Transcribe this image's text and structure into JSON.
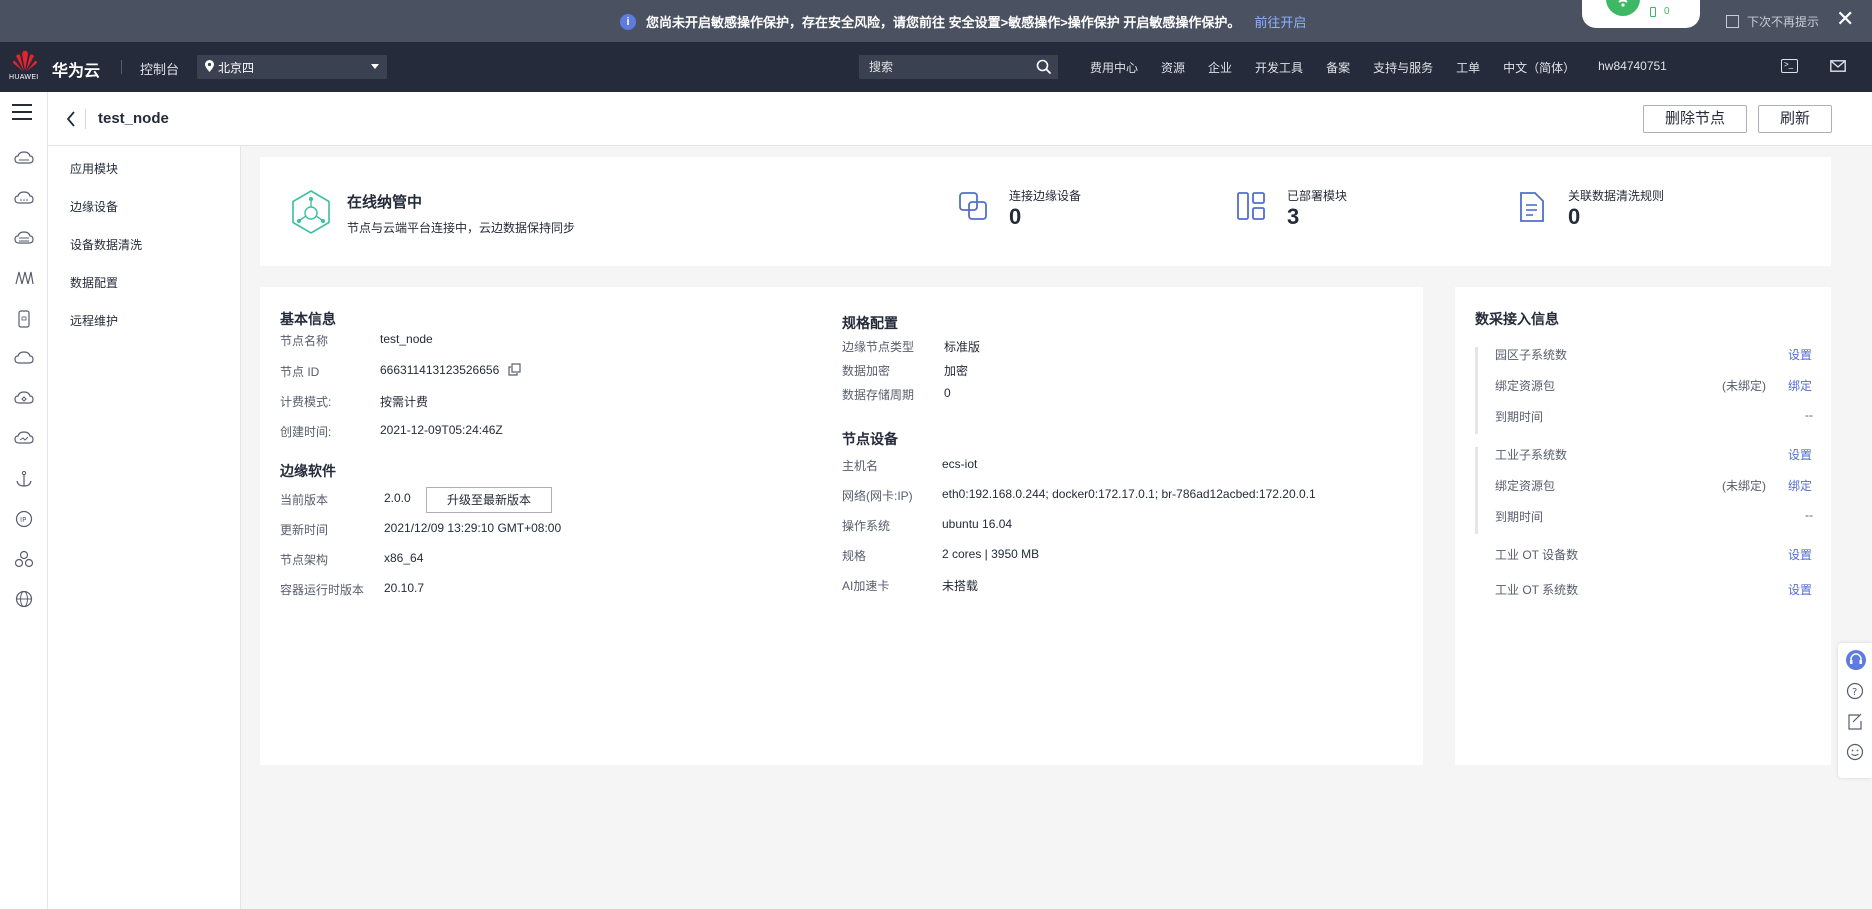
{
  "notice": {
    "message": "您尚未开启敏感操作保护，存在安全风险，请您前往 安全设置>敏感操作>操作保护 开启敏感操作保护。",
    "link": "前往开启",
    "wifi_count": "0",
    "no_remind": "下次不再提示"
  },
  "header": {
    "logo_text": "HUAWEI",
    "brand": "华为云",
    "console": "控制台",
    "region": "北京四",
    "search_placeholder": "搜索",
    "nav": [
      "费用中心",
      "资源",
      "企业",
      "开发工具",
      "备案",
      "支持与服务",
      "工单",
      "中文（简体）",
      "hw84740751"
    ],
    "term_glyph": ">_"
  },
  "subheader": {
    "title": "test_node",
    "delete_label": "删除节点",
    "refresh_label": "刷新"
  },
  "subnav": [
    "应用模块",
    "边缘设备",
    "设备数据清洗",
    "数据配置",
    "远程维护"
  ],
  "status": {
    "title": "在线纳管中",
    "desc": "节点与云端平台连接中，云边数据保持同步",
    "metrics": [
      {
        "label": "连接边缘设备",
        "value": "0"
      },
      {
        "label": "已部署模块",
        "value": "3"
      },
      {
        "label": "关联数据清洗规则",
        "value": "0"
      }
    ]
  },
  "basic": {
    "title": "基本信息",
    "name_label": "节点名称",
    "name": "test_node",
    "id_label": "节点 ID",
    "id": "666311413123526656",
    "billing_label": "计费模式:",
    "billing": "按需计费",
    "created_label": "创建时间:",
    "created": "2021-12-09T05:24:46Z"
  },
  "software": {
    "title": "边缘软件",
    "version_label": "当前版本",
    "version": "2.0.0",
    "upgrade_label": "升级至最新版本",
    "updated_label": "更新时间",
    "updated": "2021/12/09 13:29:10 GMT+08:00",
    "arch_label": "节点架构",
    "arch": "x86_64",
    "runtime_label": "容器运行时版本",
    "runtime": "20.10.7"
  },
  "spec": {
    "title": "规格配置",
    "type_label": "边缘节点类型",
    "type": "标准版",
    "encrypt_label": "数据加密",
    "encrypt": "加密",
    "storage_label": "数据存储周期",
    "storage": "0"
  },
  "device": {
    "title": "节点设备",
    "host_label": "主机名",
    "host": "ecs-iot",
    "net_label": "网络(网卡:IP)",
    "net": "eth0:192.168.0.244;  docker0:172.17.0.1;  br-786ad12acbed:172.20.0.1",
    "os_label": "操作系统",
    "os": "ubuntu 16.04",
    "spec_label": "规格",
    "spec": "2 cores | 3950 MB",
    "ai_label": "AI加速卡",
    "ai": "未搭载"
  },
  "access": {
    "title": "数采接入信息",
    "park_label": "园区子系统数",
    "park_action": "设置",
    "bind_label": "绑定资源包",
    "bind_state": "(未绑定)",
    "bind_action": "绑定",
    "expire_label": "到期时间",
    "expire": "--",
    "industry_label": "工业子系统数",
    "industry_action": "设置",
    "bind2_label": "绑定资源包",
    "bind2_state": "(未绑定)",
    "bind2_action": "绑定",
    "expire2_label": "到期时间",
    "expire2": "--",
    "ot_device_label": "工业 OT 设备数",
    "ot_device_action": "设置",
    "ot_system_label": "工业 OT 系统数",
    "ot_system_action": "设置"
  },
  "colors": {
    "accent": "#526ecc",
    "header": "#252b3a",
    "notice": "#4a5160",
    "status": "#3bc0a0"
  }
}
